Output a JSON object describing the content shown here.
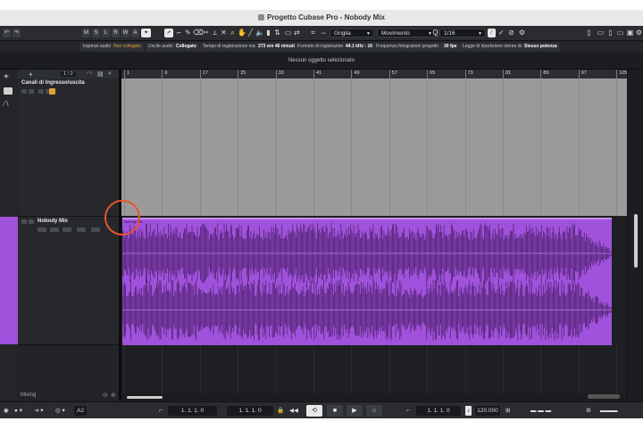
{
  "window": {
    "title": "Progetto Cubase Pro - Nobody Mix"
  },
  "toolbar": {
    "mode_buttons": [
      "M",
      "S",
      "L",
      "R",
      "W",
      "A"
    ],
    "snap_type": "Griglia",
    "grid_mode": "Movimento",
    "quantize": "1/16"
  },
  "info_line": [
    {
      "label": "Ingressi audio",
      "value": "Non collegato"
    },
    {
      "label": "Uscite audio",
      "value": "Collegato"
    },
    {
      "label": "Tempo di registrazione max",
      "value": "273 ore 46 minuti"
    },
    {
      "label": "Formato di registrazione",
      "value": "44.1 kHz - 16 bit"
    },
    {
      "label": "Frequenza fotogrammi progetto",
      "value": "30 fps"
    },
    {
      "label": "Legge di ripartizione stereo del",
      "value": "Stesso potenza"
    }
  ],
  "status": {
    "text": "Nessun oggetto selezionato"
  },
  "track_list": {
    "counter": "1 / 2",
    "tracks": [
      {
        "name": "Canali di Ingresso/uscita",
        "type": "folder"
      },
      {
        "name": "Nobody Mix",
        "type": "audio"
      }
    ],
    "mixing_label": "Mixing"
  },
  "ruler": {
    "bars": [
      "1",
      "9",
      "17",
      "25",
      "33",
      "41",
      "49",
      "57",
      "65",
      "73",
      "81",
      "89",
      "97",
      "105"
    ]
  },
  "clip": {
    "name": "Nobody Mix",
    "color": "#a052dc"
  },
  "transport": {
    "left_locator": "1. 1. 1.  0",
    "right_locator": "1. 1. 1.  0",
    "position": "1. 1. 1.  0",
    "autosave_label": "A2",
    "tempo": "120.000",
    "signature": "4/4"
  },
  "colors": {
    "accent": "#e9562c",
    "clip": "#a052dc",
    "folder_lane": "#9a9a9a"
  }
}
